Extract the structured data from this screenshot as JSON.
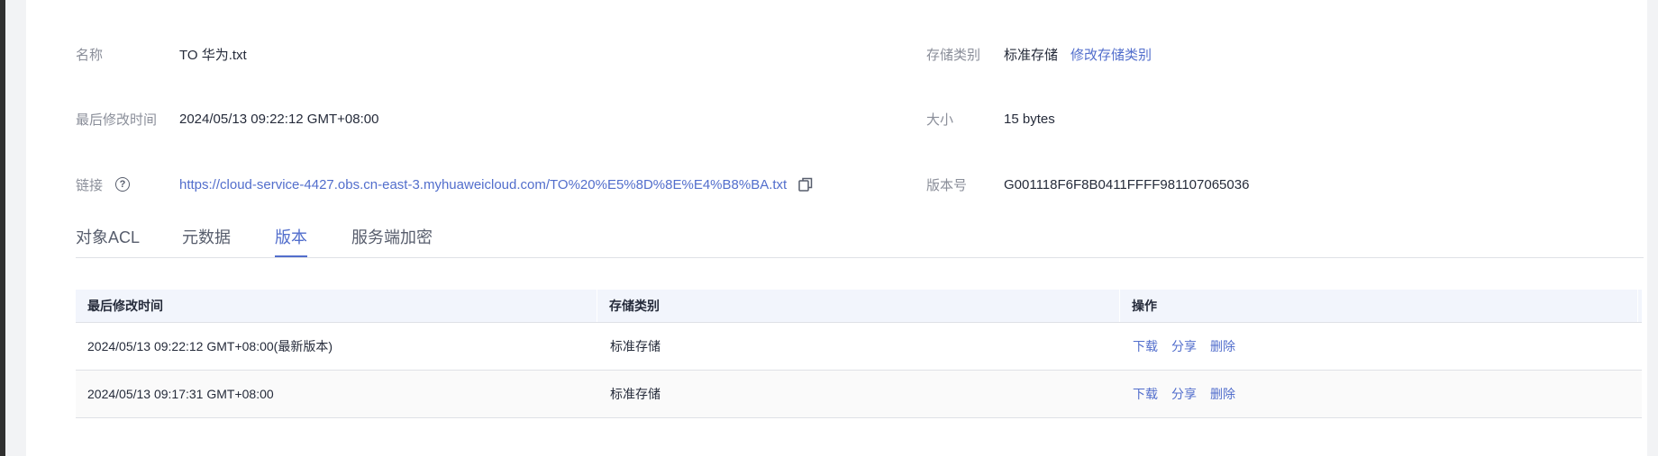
{
  "info": {
    "name_label": "名称",
    "name_value": "TO 华为.txt",
    "storage_class_label": "存储类别",
    "storage_class_value": "标准存储",
    "modify_storage_class_link": "修改存储类别",
    "last_modified_label": "最后修改时间",
    "last_modified_value": "2024/05/13 09:22:12 GMT+08:00",
    "size_label": "大小",
    "size_value": "15 bytes",
    "link_label": "链接",
    "link_value": "https://cloud-service-4427.obs.cn-east-3.myhuaweicloud.com/TO%20%E5%8D%8E%E4%B8%BA.txt",
    "version_label": "版本号",
    "version_value": "G001118F6F8B0411FFFF981107065036"
  },
  "tabs": [
    {
      "label": "对象ACL",
      "active": false
    },
    {
      "label": "元数据",
      "active": false
    },
    {
      "label": "版本",
      "active": true
    },
    {
      "label": "服务端加密",
      "active": false
    }
  ],
  "table": {
    "columns": [
      "最后修改时间",
      "存储类别",
      "操作"
    ],
    "rows": [
      {
        "modified": "2024/05/13 09:22:12 GMT+08:00(最新版本)",
        "storage_class": "标准存储",
        "actions": [
          "下载",
          "分享",
          "删除"
        ]
      },
      {
        "modified": "2024/05/13 09:17:31 GMT+08:00",
        "storage_class": "标准存储",
        "actions": [
          "下载",
          "分享",
          "删除"
        ]
      }
    ]
  },
  "colors": {
    "accent": "#526ecc",
    "label": "#8a8e99",
    "text": "#252b3a",
    "header_bg": "#f2f5fc"
  }
}
